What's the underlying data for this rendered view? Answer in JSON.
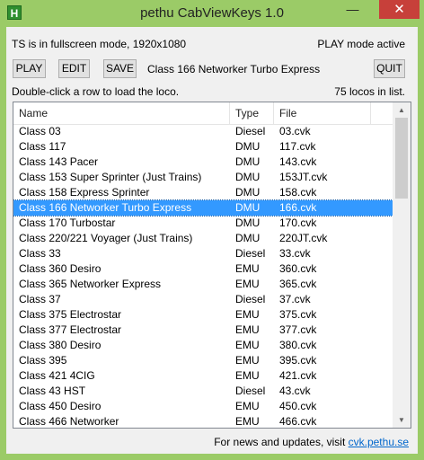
{
  "window": {
    "title": "pethu CabViewKeys 1.0",
    "icon_letter": "H",
    "controls": {
      "minimize": "—",
      "maximize": "□",
      "close": "✕"
    }
  },
  "status": {
    "mode": "TS is in fullscreen mode, 1920x1080",
    "play_state": "PLAY mode active"
  },
  "toolbar": {
    "play_label": "PLAY",
    "edit_label": "EDIT",
    "save_label": "SAVE",
    "quit_label": "QUIT",
    "current_loco": "Class 166 Networker Turbo Express"
  },
  "hint": "Double-click a row to load the loco.",
  "count": "75 locos in list.",
  "list": {
    "columns": [
      "Name",
      "Type",
      "File"
    ],
    "selected_index": 5,
    "rows": [
      [
        "Class 03",
        "Diesel",
        "03.cvk"
      ],
      [
        "Class 117",
        "DMU",
        "117.cvk"
      ],
      [
        "Class 143 Pacer",
        "DMU",
        "143.cvk"
      ],
      [
        "Class 153 Super Sprinter (Just Trains)",
        "DMU",
        "153JT.cvk"
      ],
      [
        "Class 158 Express Sprinter",
        "DMU",
        "158.cvk"
      ],
      [
        "Class 166 Networker Turbo Express",
        "DMU",
        "166.cvk"
      ],
      [
        "Class 170 Turbostar",
        "DMU",
        "170.cvk"
      ],
      [
        "Class 220/221 Voyager (Just Trains)",
        "DMU",
        "220JT.cvk"
      ],
      [
        "Class 33",
        "Diesel",
        "33.cvk"
      ],
      [
        "Class 360 Desiro",
        "EMU",
        "360.cvk"
      ],
      [
        "Class 365 Networker Express",
        "EMU",
        "365.cvk"
      ],
      [
        "Class 37",
        "Diesel",
        "37.cvk"
      ],
      [
        "Class 375 Electrostar",
        "EMU",
        "375.cvk"
      ],
      [
        "Class 377 Electrostar",
        "EMU",
        "377.cvk"
      ],
      [
        "Class 380 Desiro",
        "EMU",
        "380.cvk"
      ],
      [
        "Class 395",
        "EMU",
        "395.cvk"
      ],
      [
        "Class 421 4CIG",
        "EMU",
        "421.cvk"
      ],
      [
        "Class 43 HST",
        "Diesel",
        "43.cvk"
      ],
      [
        "Class 450 Desiro",
        "EMU",
        "450.cvk"
      ],
      [
        "Class 466 Networker",
        "EMU",
        "466.cvk"
      ]
    ]
  },
  "footer": {
    "text": "For news and updates, visit",
    "link": "cvk.pethu.se"
  },
  "scroll_arrows": {
    "up": "▲",
    "down": "▼"
  }
}
